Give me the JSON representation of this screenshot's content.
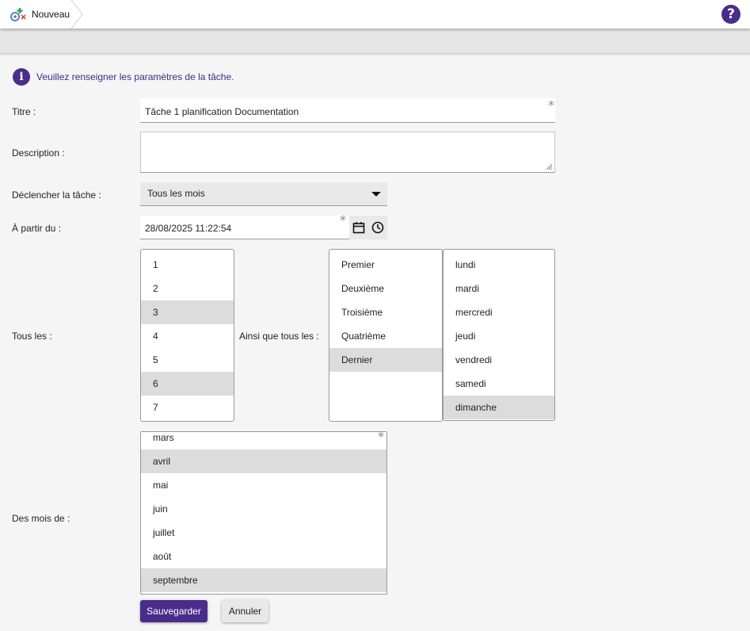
{
  "header": {
    "breadcrumb_label": "Nouveau",
    "breadcrumb_icon": "task-schedule-icon",
    "help_label": "?",
    "help_icon": "help-icon"
  },
  "info": {
    "icon": "info-icon",
    "icon_glyph": "i",
    "message": "Veuillez renseigner les paramètres de la tâche."
  },
  "form": {
    "title": {
      "label": "Titre :",
      "value": "Tâche 1 planification Documentation",
      "required_mark": "*"
    },
    "description": {
      "label": "Description :",
      "value": ""
    },
    "trigger": {
      "label": "Déclencher la tâche :",
      "value": "Tous les mois"
    },
    "start": {
      "label": "À partir du :",
      "value": "28/08/2025 11:22:54",
      "required_mark": "*"
    },
    "days": {
      "label": "Tous les :",
      "options": [
        "1",
        "2",
        "3",
        "4",
        "5",
        "6",
        "7"
      ],
      "selected": [
        "3",
        "6"
      ]
    },
    "also": {
      "label": "Ainsi que tous les :",
      "ordinals": [
        "Premier",
        "Deuxième",
        "Troisième",
        "Quatrième",
        "Dernier"
      ],
      "ordinals_selected": [
        "Dernier"
      ],
      "weekdays": [
        "lundi",
        "mardi",
        "mercredi",
        "jeudi",
        "vendredi",
        "samedi",
        "dimanche"
      ],
      "weekdays_selected": [
        "dimanche"
      ]
    },
    "months": {
      "label": "Des mois de :",
      "options": [
        "mars",
        "avril",
        "mai",
        "juin",
        "juillet",
        "août",
        "septembre"
      ],
      "selected": [
        "avril",
        "septembre"
      ],
      "required_mark": "*"
    }
  },
  "actions": {
    "save_label": "Sauvegarder",
    "cancel_label": "Annuler"
  },
  "colors": {
    "accent": "#4a2c8a",
    "selected_row": "#dcdcdc",
    "page_bg": "#f5f5f5"
  }
}
